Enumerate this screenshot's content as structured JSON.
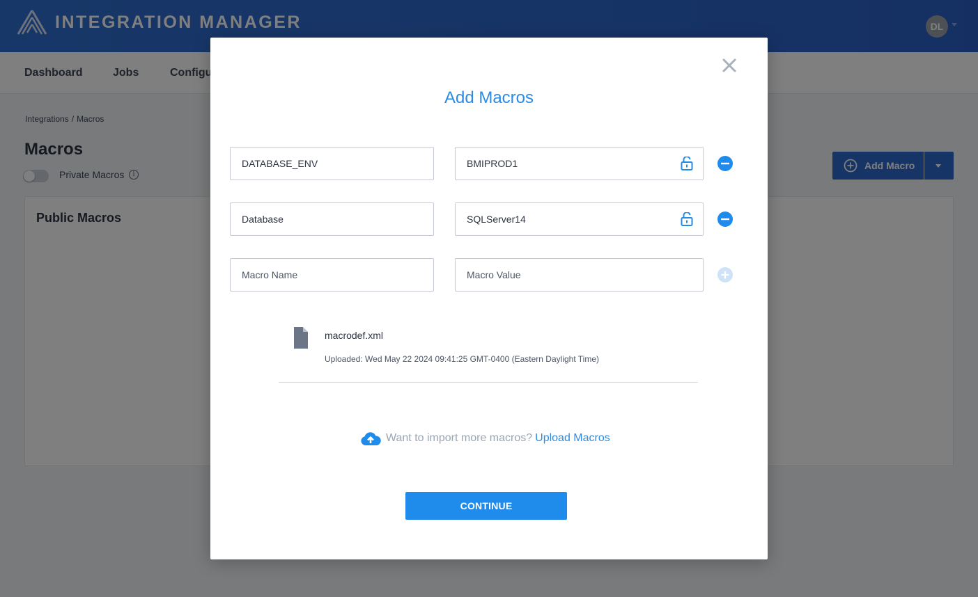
{
  "app": {
    "brand": "INTEGRATION MANAGER",
    "user_initials": "DL"
  },
  "nav": {
    "items": [
      {
        "label": "Dashboard"
      },
      {
        "label": "Jobs"
      },
      {
        "label": "Configu"
      }
    ]
  },
  "breadcrumb": {
    "parent": "Integrations",
    "separator": "/",
    "current": "Macros"
  },
  "page": {
    "title": "Macros",
    "private_toggle_label": "Private Macros",
    "private_toggle_on": false,
    "info_glyph": "i",
    "add_button_label": "Add Macro",
    "public_panel_title": "Public Macros"
  },
  "modal": {
    "title": "Add Macros",
    "close_glyph": "×",
    "rows": [
      {
        "name": "DATABASE_ENV",
        "value": "BMIPROD1",
        "lock_icon": "unlock-icon",
        "action_icon": "minus-circle-icon"
      },
      {
        "name": "Database",
        "value": "SQLServer14",
        "lock_icon": "unlock-icon",
        "action_icon": "minus-circle-icon"
      }
    ],
    "new_row": {
      "name_placeholder": "Macro Name",
      "value_placeholder": "Macro Value",
      "action_icon": "plus-circle-icon"
    },
    "file": {
      "name": "macrodef.xml",
      "uploaded": "Uploaded: Wed May 22 2024 09:41:25 GMT-0400 (Eastern Daylight Time)",
      "icon": "file-icon"
    },
    "upload": {
      "prompt": "Want to import more macros?",
      "link": "Upload Macros",
      "icon": "cloud-upload-icon"
    },
    "continue_label": "CONTINUE"
  },
  "colors": {
    "header_blue": "#2d68cc",
    "accent_blue": "#2b8be5",
    "button_blue": "#1f8ceb"
  }
}
